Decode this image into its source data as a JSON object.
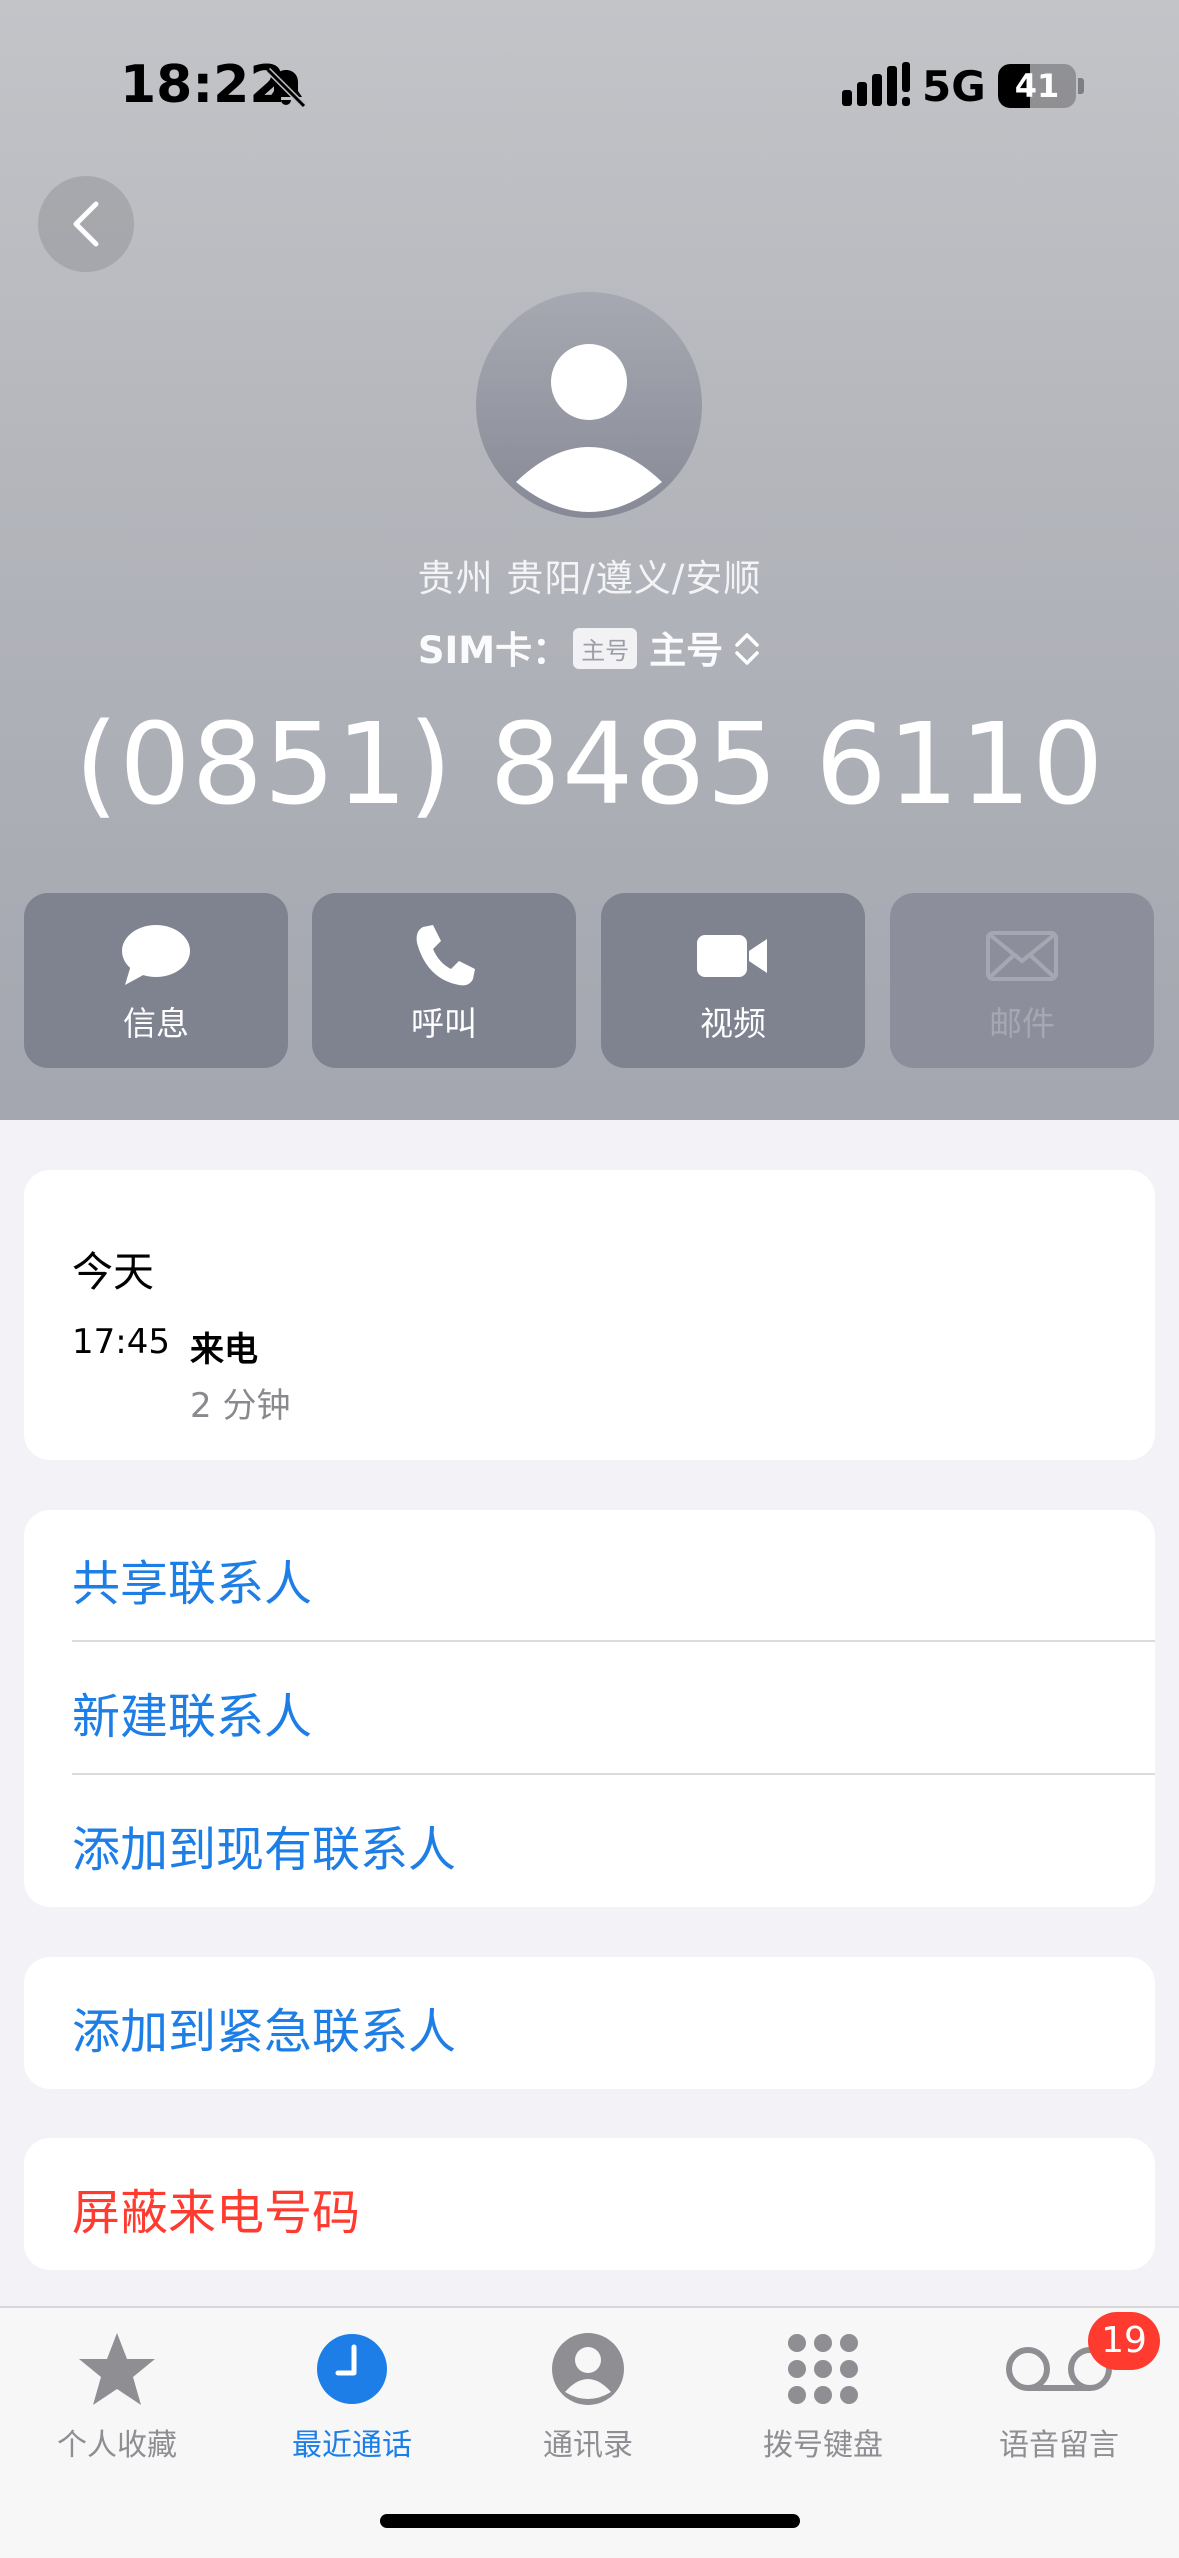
{
  "status_bar": {
    "time": "18:22",
    "network": "5G",
    "battery": "41",
    "battery_level": 0.41
  },
  "contact": {
    "location": "贵州 贵阳/遵义/安顺",
    "sim_label": "SIM卡：",
    "sim_badge": "主号",
    "sim_value": "主号",
    "phone_number": "(0851) 8485 6110"
  },
  "actions": [
    {
      "label": "信息",
      "icon": "message-icon",
      "enabled": true
    },
    {
      "label": "呼叫",
      "icon": "phone-icon",
      "enabled": true
    },
    {
      "label": "视频",
      "icon": "video-icon",
      "enabled": true
    },
    {
      "label": "邮件",
      "icon": "mail-icon",
      "enabled": false
    }
  ],
  "call_log": {
    "day": "今天",
    "time": "17:45",
    "type": "来电",
    "duration": "2 分钟"
  },
  "options": {
    "share_contact": "共享联系人",
    "new_contact": "新建联系人",
    "add_existing": "添加到现有联系人",
    "add_emergency": "添加到紧急联系人",
    "block_caller": "屏蔽来电号码"
  },
  "tabbar": {
    "items": [
      {
        "label": "个人收藏",
        "icon": "star-icon"
      },
      {
        "label": "最近通话",
        "icon": "clock-icon",
        "active": true
      },
      {
        "label": "通讯录",
        "icon": "person-circle-icon"
      },
      {
        "label": "拨号键盘",
        "icon": "keypad-icon"
      },
      {
        "label": "语音留言",
        "icon": "voicemail-icon"
      }
    ],
    "voicemail_badge": "19"
  },
  "colors": {
    "accent": "#1c7ee6",
    "destructive": "#ff3b30",
    "action_button": "#7f828f",
    "background": "#f2f2f7"
  }
}
